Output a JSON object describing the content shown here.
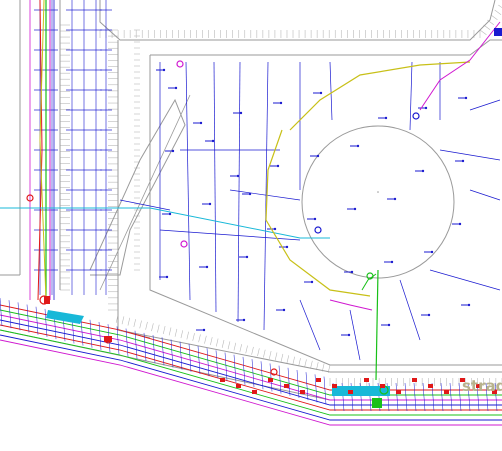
{
  "map": {
    "street_label": "strad",
    "colors": {
      "background": "#ffffff",
      "curb_gray": "#9a9a9a",
      "hatch_gray": "#b9b9b9",
      "blue_line": "#1a1ad0",
      "red_line": "#e01818",
      "green_line": "#18c018",
      "magenta_line": "#d018d0",
      "cyan_line": "#18b8d8",
      "yellow_line": "#c8c018",
      "label_tan": "#b8b28c"
    },
    "layers": [
      {
        "name": "property-boundaries",
        "color": "gray"
      },
      {
        "name": "survey-points",
        "color": "blue"
      },
      {
        "name": "sewer",
        "color": "red"
      },
      {
        "name": "water",
        "color": "green"
      },
      {
        "name": "electric",
        "color": "magenta"
      },
      {
        "name": "telecom",
        "color": "cyan"
      },
      {
        "name": "gas",
        "color": "yellow"
      }
    ]
  }
}
